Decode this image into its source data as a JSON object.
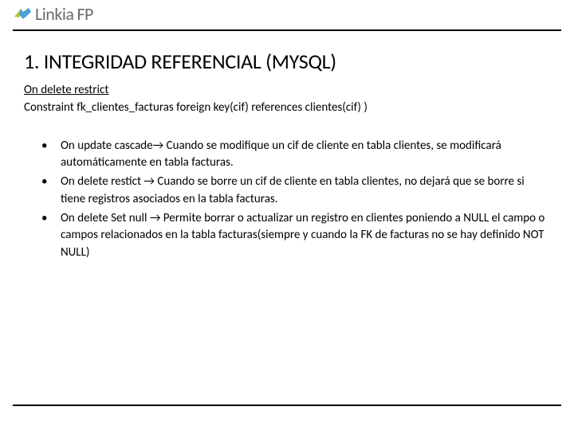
{
  "brand": {
    "name": "Linkia",
    "suffix": "FP"
  },
  "title": "1. INTEGRIDAD REFERENCIAL (MYSQL)",
  "subhead1": "On delete restrict",
  "subhead2": "Constraint  fk_clientes_facturas foreign key(cif) references clientes(cif) )",
  "bullets": [
    "On update cascade→ Cuando se modifique un cif de cliente en tabla clientes, se modificará automáticamente en tabla facturas.",
    "On delete restict → Cuando se borre un cif de cliente en tabla clientes, no dejará que se borre si tiene registros asociados en la tabla facturas.",
    "On delete Set null → Permite borrar o actualizar un registro en clientes poniendo a NULL el campo o campos relacionados en la tabla facturas(siempre y cuando la FK de facturas no se hay definido NOT NULL)"
  ]
}
